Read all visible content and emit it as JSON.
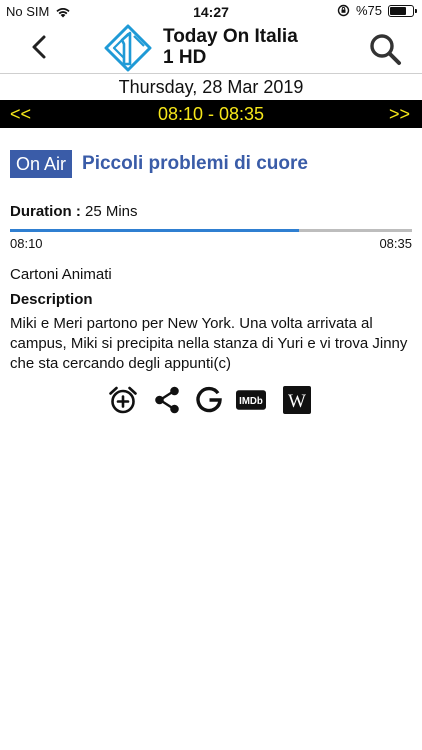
{
  "status_bar": {
    "carrier": "No SIM",
    "time": "14:27",
    "battery_text": "%75",
    "battery_level": 0.75
  },
  "header": {
    "channel_line1": "Today On Italia",
    "channel_line2": "1 HD",
    "logo_icon": "italia1-logo-icon",
    "back_icon": "chevron-left-icon",
    "search_icon": "search-icon"
  },
  "schedule": {
    "date": "Thursday, 28 Mar 2019",
    "prev_label": "<<",
    "next_label": ">>",
    "time_slot": "08:10 - 08:35"
  },
  "program": {
    "badge": "On Air",
    "title": "Piccoli problemi di cuore",
    "duration_label": "Duration :",
    "duration_value": "25 Mins",
    "start_time": "08:10",
    "end_time": "08:35",
    "progress": 0.72,
    "genre": "Cartoni Animati",
    "description_label": "Description",
    "description": "Miki e Meri partono per New York. Una volta arrivata al campus, Miki si precipita nella stanza di Yuri e vi trova Jinny che sta cercando degli appunti(c)"
  },
  "actions": {
    "items": [
      "alarm-add-icon",
      "share-icon",
      "google-icon",
      "imdb-icon",
      "wikipedia-icon"
    ],
    "imdb_text": "IMDb",
    "wikipedia_text": "W"
  },
  "colors": {
    "accent": "#3a5ca8",
    "time_bar_bg": "#000000",
    "time_bar_text": "#f5e61a",
    "progress_fill": "#2f7fd1",
    "progress_track": "#bdbdbd"
  }
}
